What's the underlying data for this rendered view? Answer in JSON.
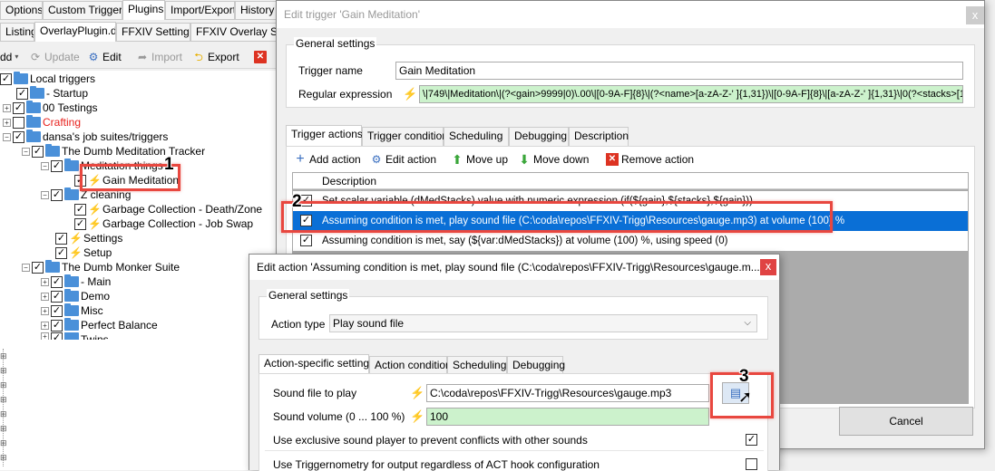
{
  "main_tabs": [
    "Options",
    "Custom Triggers",
    "Plugins",
    "Import/Export",
    "History D"
  ],
  "sub_tabs": [
    "Listing",
    "OverlayPlugin.dll",
    "FFXIV Settings",
    "FFXIV Overlay Set"
  ],
  "toolbar": {
    "add": "dd",
    "update": "Update",
    "edit": "Edit",
    "import": "Import",
    "export": "Export"
  },
  "tree": [
    {
      "label": "Local triggers"
    },
    {
      "label": "- Startup"
    },
    {
      "label": "00 Testings"
    },
    {
      "label": "Crafting",
      "color": "#e8201c"
    },
    {
      "label": "dansa's job suites/triggers"
    },
    {
      "label": "The Dumb Meditation Tracker"
    },
    {
      "label": "Meditation things"
    },
    {
      "label": "Gain Meditation"
    },
    {
      "label": "Z cleaning"
    },
    {
      "label": "Garbage Collection - Death/Zone"
    },
    {
      "label": "Garbage Collection - Job Swap"
    },
    {
      "label": "Settings"
    },
    {
      "label": "Setup"
    },
    {
      "label": "The Dumb Monker Suite"
    },
    {
      "label": "- Main"
    },
    {
      "label": "Demo"
    },
    {
      "label": "Misc"
    },
    {
      "label": "Perfect Balance"
    },
    {
      "label": "Twins"
    }
  ],
  "annotations": [
    "1",
    "2",
    "3"
  ],
  "edit_trigger": {
    "title": "Edit trigger 'Gain Meditation'",
    "general_settings": "General settings",
    "trigger_name_label": "Trigger name",
    "trigger_name": "Gain Meditation",
    "regex_label": "Regular expression",
    "regex": "\\|749\\|Meditation\\|(?<gain>9999|0)\\.00\\|[0-9A-F]{8}\\|(?<name>[a-zA-Z-' ]{1,31})\\|[0-9A-F]{8}\\|[a-zA-Z-' ]{1,31}\\|0(?<stacks>[1-3]",
    "tabs": [
      "Trigger actions",
      "Trigger condition",
      "Scheduling",
      "Debugging",
      "Description"
    ],
    "actions_toolbar": {
      "add": "Add action",
      "edit": "Edit action",
      "up": "Move up",
      "down": "Move down",
      "remove": "Remove action"
    },
    "column": "Description",
    "rows": [
      "Set scalar variable (dMedStacks) value with numeric expression (if(${gain},${stacks},${gain}))",
      "Assuming condition is met, play sound file (C:\\coda\\repos\\FFXIV-Trigg\\Resources\\gauge.mp3) at volume (100) %",
      "Assuming condition is met, say (${var:dMedStacks}) at volume (100) %, using speed (0)"
    ],
    "cancel": "Cancel"
  },
  "edit_action": {
    "title": "Edit action 'Assuming condition is met, play sound file (C:\\coda\\repos\\FFXIV-Trigg\\Resources\\gauge.m...",
    "general_settings": "General settings",
    "action_type_label": "Action type",
    "action_type": "Play sound file",
    "tabs": [
      "Action-specific settings",
      "Action condition",
      "Scheduling",
      "Debugging"
    ],
    "sound_file_label": "Sound file to play",
    "sound_file": "C:\\coda\\repos\\FFXIV-Trigg\\Resources\\gauge.mp3",
    "volume_label": "Sound volume (0 ... 100 %)",
    "volume": "100",
    "exclusive_label": "Use exclusive sound player to prevent conflicts with other sounds",
    "triggernometry_label": "Use Triggernometry for output regardless of ACT hook configuration"
  },
  "close_glyph": "x"
}
